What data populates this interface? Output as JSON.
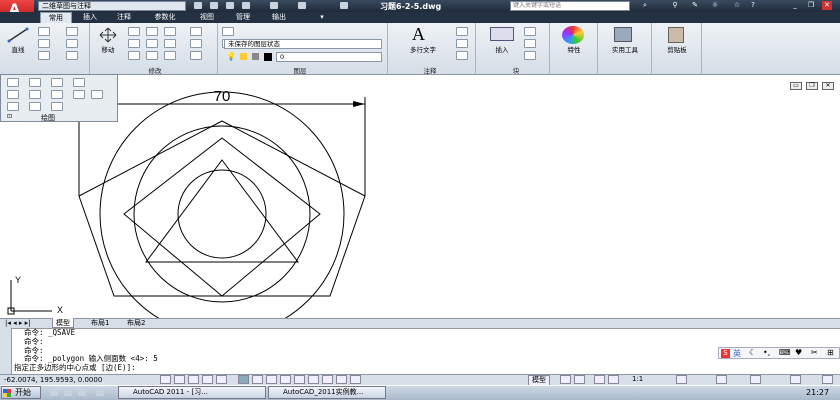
{
  "title_bar": {
    "app_logo_letter": "A",
    "workspace": "二维草图与注释",
    "document_title": "习题6-2-5.dwg",
    "search_placeholder": "键入关键字或短语"
  },
  "ribbon_tabs": [
    "常用",
    "插入",
    "注释",
    "参数化",
    "视图",
    "管理",
    "输出"
  ],
  "ribbon": {
    "line_label": "直线",
    "move_label": "移动",
    "layer_state": "未保存的图层状态",
    "layer_name": "0",
    "mtext_label": "多行文字",
    "insert_label": "插入",
    "properties_label": "特性",
    "utilities_label": "实用工具",
    "clipboard_label": "剪贴板",
    "panels": {
      "modify": "修改",
      "layers": "图层",
      "annotation": "注释",
      "block": "块"
    },
    "draw_panel_title": "绘图"
  },
  "drawing": {
    "dimension_text": "70",
    "ucs_x": "X",
    "ucs_y": "Y"
  },
  "layout_tabs": [
    "模型",
    "布局1",
    "布局2"
  ],
  "command_lines": [
    "命令: _QSAVE",
    "命令:",
    "命令:",
    "命令: _polygon 输入侧面数 <4>: 5",
    "指定正多边形的中心点或 [边(E)]:"
  ],
  "status_bar": {
    "coordinates": "-62.0074, 195.9593, 0.0000",
    "model_label": "模型",
    "scale": "1:1"
  },
  "taskbar": {
    "start_label": "开始",
    "tasks": [
      "AutoCAD 2011 - [习...",
      "AutoCAD_2011实例教..."
    ],
    "ime_label": "英",
    "clock": "21:27"
  },
  "colors": {
    "title_bg": "#243142",
    "ribbon_bg": "#e3e9f0",
    "logo_red": "#cc2222"
  }
}
